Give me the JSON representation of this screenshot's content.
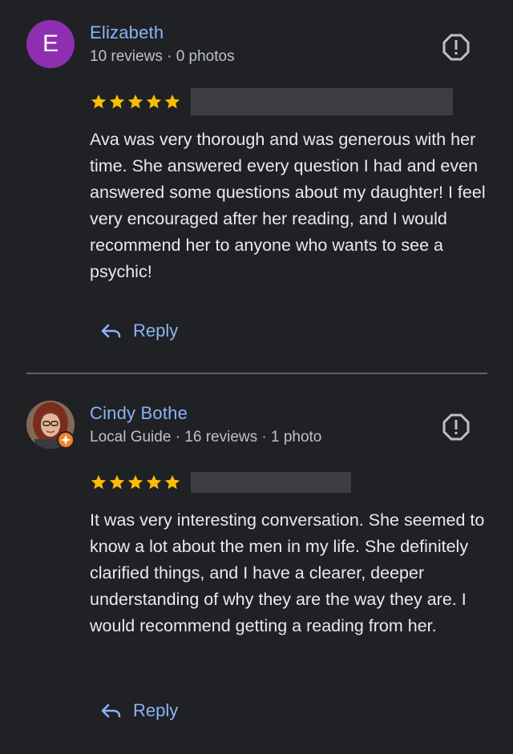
{
  "reviews": [
    {
      "avatar_letter": "E",
      "avatar_color": "#8e2fb2",
      "author": "Elizabeth",
      "meta": "10 reviews · 0 photos",
      "rating": 5,
      "text": "Ava was very thorough and was generous with her time. She answered every question I had and even answered some questions about my daughter! I feel very encouraged after her reading, and I would recommend her to anyone who wants to see a psychic!",
      "reply_label": "Reply",
      "flag_icon": "report-flag-icon"
    },
    {
      "avatar_letter": "",
      "author": "Cindy Bothe",
      "meta": "Local Guide · 16 reviews · 1 photo",
      "rating": 5,
      "text": "It was very interesting conversation. She seemed to know a lot about the men in my life. She definitely clarified things, and I have a clearer, deeper understanding of why they are the way they are. I would recommend getting a reading from her.",
      "reply_label": "Reply",
      "flag_icon": "report-flag-icon",
      "local_guide_badge_color": "#f5822a"
    }
  ],
  "colors": {
    "background": "#202124",
    "link": "#8ab4f8",
    "star": "#fbbc04",
    "redaction": "#3c3e42"
  }
}
